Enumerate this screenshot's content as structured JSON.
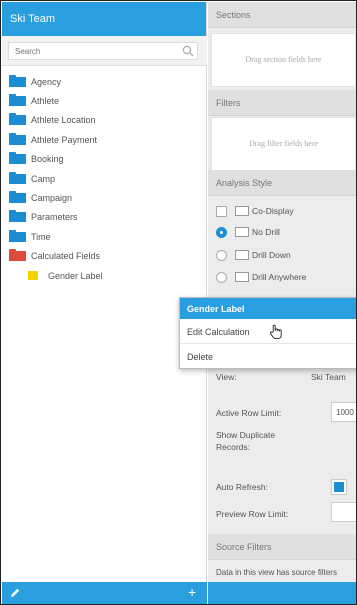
{
  "left_panel": {
    "title": "Ski Team",
    "search_placeholder": "Search",
    "folders": [
      {
        "label": "Agency",
        "color": "#1b8ed3"
      },
      {
        "label": "Athlete",
        "color": "#1b8ed3"
      },
      {
        "label": "Athlete Location",
        "color": "#1b8ed3"
      },
      {
        "label": "Athlete Payment",
        "color": "#1b8ed3"
      },
      {
        "label": "Booking",
        "color": "#1b8ed3"
      },
      {
        "label": "Camp",
        "color": "#1b8ed3"
      },
      {
        "label": "Campaign",
        "color": "#1b8ed3"
      },
      {
        "label": "Parameters",
        "color": "#1b8ed3"
      },
      {
        "label": "Time",
        "color": "#1b8ed3"
      },
      {
        "label": "Calculated Fields",
        "color": "#e04a3a"
      }
    ],
    "calculated_field": "Gender Label",
    "footer_add": "+"
  },
  "right_panel": {
    "sections_header": "Sections",
    "sections_drop": "Drag section fields here",
    "filters_header": "Filters",
    "filters_drop": "Drag filter fields here",
    "analysis_header": "Analysis Style",
    "co_display": "Co-Display",
    "no_drill": "No Drill",
    "drill_down": "Drill Down",
    "drill_anywhere": "Drill Anywhere",
    "view_label": "View:",
    "view_value": "Ski Team",
    "active_row_limit_label": "Active Row Limit:",
    "active_row_limit_value": "1000",
    "show_duplicate_label_1": "Show Duplicate",
    "show_duplicate_label_2": "Records:",
    "auto_refresh_label": "Auto Refresh:",
    "preview_row_limit_label": "Preview Row Limit:",
    "source_filters_header": "Source Filters",
    "source_filters_text": "Data in this view has source filters"
  },
  "context_menu": {
    "title": "Gender Label",
    "edit": "Edit Calculation",
    "delete": "Delete"
  },
  "colors": {
    "accent": "#2a9fe0",
    "folder_blue": "#1b8ed3",
    "folder_red": "#e04a3a",
    "field_yellow": "#f2d400"
  }
}
